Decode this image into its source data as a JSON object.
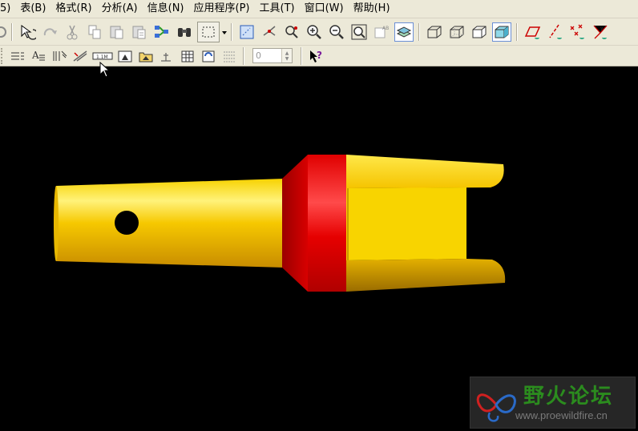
{
  "menu": {
    "items": [
      "5)",
      "表(B)",
      "格式(R)",
      "分析(A)",
      "信息(N)",
      "应用程序(P)",
      "工具(T)",
      "窗口(W)",
      "帮助(H)"
    ]
  },
  "toolbar_main": {
    "icons": [
      "rotate-icon",
      "redo-icon",
      "cut-icon",
      "copy-icon",
      "paste-icon",
      "paste-special-icon",
      "regenerate-icon",
      "find-icon",
      "select-box-icon",
      "dropdown-arrow-icon",
      "repaint-icon",
      "spin-center-icon",
      "orient-icon",
      "zoom-in-icon",
      "zoom-out-icon",
      "refit-icon",
      "view-manager-icon",
      "layers-icon",
      "wireframe-icon",
      "hidden-line-icon",
      "no-hidden-icon",
      "shading-icon",
      "datum-planes-icon",
      "datum-axes-icon",
      "datum-points-icon",
      "coordinate-systems-icon"
    ]
  },
  "toolbar_secondary": {
    "spinner_value": "0",
    "icons": [
      "parameters-icon",
      "text-style-icon",
      "hatch-icon",
      "break-icon",
      "dimension-format-icon",
      "note-view-icon",
      "note-folder-icon",
      "drafting-icon",
      "table-icon",
      "update-table-icon",
      "repeat-region-icon",
      "context-help-icon"
    ]
  },
  "viewport": {
    "background": "#000000",
    "part_color": "#f5c400",
    "collar_color": "#e00000"
  },
  "watermark": {
    "title": "野火论坛",
    "url": "www.proewildfire.cn"
  }
}
